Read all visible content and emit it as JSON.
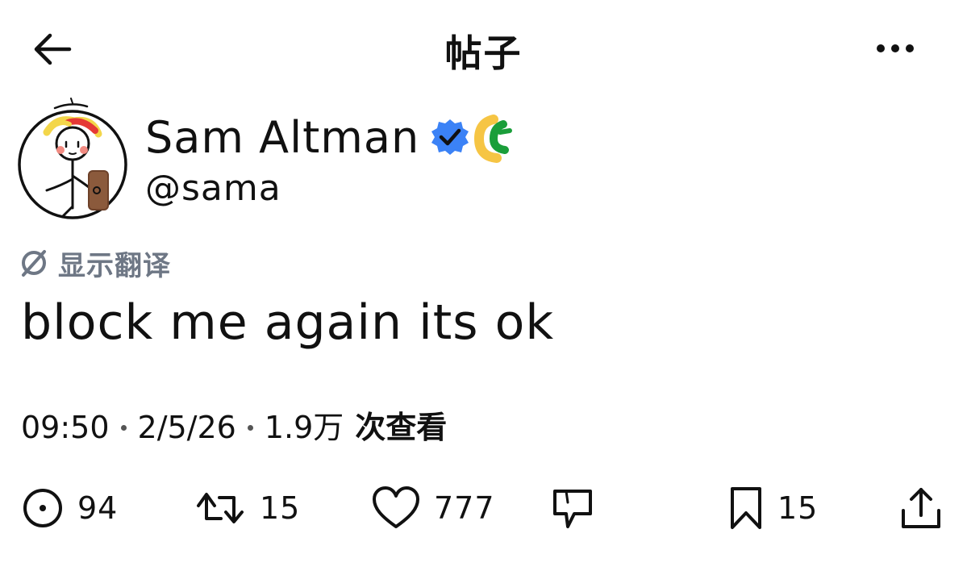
{
  "header": {
    "title": "帖子",
    "back_icon": "arrow-left-icon",
    "more_icon": "more-horizontal-icon"
  },
  "author": {
    "name": "Sam Altman",
    "handle": "@sama",
    "verified_icon": "verified-badge-icon",
    "affiliate_icon": "affiliate-badge-icon",
    "colors": {
      "verified": "#3b82f6",
      "affiliate_outer": "#f6c544",
      "affiliate_inner": "#1a9e3a"
    }
  },
  "translate": {
    "label": "显示翻译",
    "icon": "translate-icon",
    "color": "#6e7785"
  },
  "post": {
    "text": "block me again its ok"
  },
  "meta": {
    "time": "09:50",
    "date": "2/5/26",
    "views_value": "1.9万",
    "views_label": "次查看"
  },
  "actions": {
    "replies": "94",
    "reposts": "15",
    "likes": "777",
    "bookmarks": "15",
    "reply_icon": "reply-icon",
    "repost_icon": "repost-icon",
    "like_icon": "heart-icon",
    "quote_icon": "quote-bubble-icon",
    "bookmark_icon": "bookmark-icon",
    "share_icon": "share-icon"
  }
}
